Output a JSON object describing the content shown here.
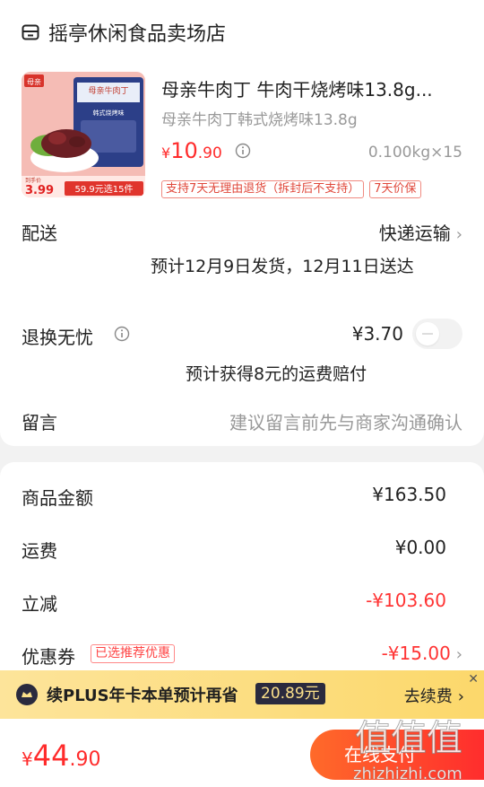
{
  "shop": {
    "name": "摇亭休闲食品卖场店",
    "icon": "shop-icon"
  },
  "product": {
    "title": "母亲牛肉丁 牛肉干烧烤味13.8g...",
    "sku": "母亲牛肉丁韩式烧烤味13.8g",
    "price_yen": "¥",
    "price_int": "10",
    "price_dec": ".90",
    "unit_qty": "0.100kg×15",
    "tags": [
      "支持7天无理由退货（拆封后不支持）",
      "7天价保"
    ],
    "image": {
      "brand": "母亲",
      "package_text": "母亲牛肉丁",
      "package_subtext": "韩式烧烤味",
      "promo_price": "3.99",
      "promo_caption": "到手价",
      "promo_deal": "59.9元选15件"
    }
  },
  "delivery": {
    "label": "配送",
    "method": "快递运输",
    "estimate": "预计12月9日发货，12月11日送达"
  },
  "returns": {
    "label": "退换无忧",
    "price": "¥3.70",
    "note": "预计获得8元的运费赔付"
  },
  "message": {
    "label": "留言",
    "placeholder": "建议留言前先与商家沟通确认"
  },
  "summary": {
    "items_label": "商品金额",
    "items_value": "¥163.50",
    "shipping_label": "运费",
    "shipping_value": "¥0.00",
    "discount_label": "立减",
    "discount_value": "-¥103.60",
    "coupon_label": "优惠券",
    "coupon_badge": "已选推荐优惠",
    "coupon_value": "-¥15.00"
  },
  "plus_banner": {
    "text": "续PLUS年卡本单预计再省",
    "amount": "20.89元",
    "action": "去续费",
    "close": "✕"
  },
  "bottom": {
    "total_yen": "¥",
    "total_int": "44",
    "total_dec": ".90",
    "pay_label": "在线支付"
  },
  "watermark": {
    "text": "值值值",
    "url": "zhizhizhi.com"
  },
  "colors": {
    "accent_red": "#ff2b2b",
    "plus_bar": "#fcd86b",
    "plus_dark": "#2a2a3e",
    "pay_gradient_start": "#ff6a2a",
    "pay_gradient_end": "#ff2d2d"
  }
}
